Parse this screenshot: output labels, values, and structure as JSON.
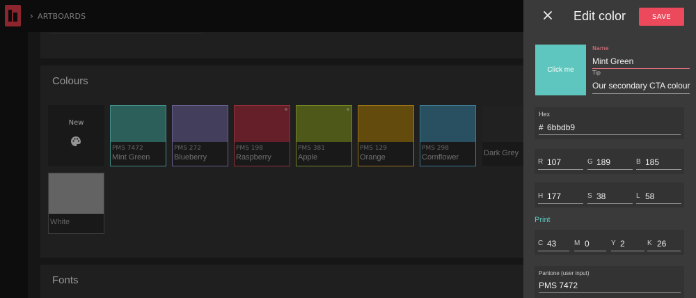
{
  "header": {
    "breadcrumb": "ARTBOARDS",
    "logo_color": "#c2343f"
  },
  "main": {
    "colours_title": "Colours",
    "fonts_title": "Fonts",
    "new_label": "New",
    "swatches": [
      {
        "pms": "PMS 7472",
        "name": "Mint Green",
        "color": "#3e837d",
        "border": "#5ec6be"
      },
      {
        "pms": "PMS 272",
        "name": "Blueberry",
        "color": "#5d5680",
        "border": "#8f86c4"
      },
      {
        "pms": "PMS 198",
        "name": "Raspberry",
        "color": "#8b2b3a",
        "border": "#c9434f"
      },
      {
        "pms": "PMS 381",
        "name": "Apple",
        "color": "#6d7a22",
        "border": "#a3b635"
      },
      {
        "pms": "PMS 129",
        "name": "Orange",
        "color": "#8a6812",
        "border": "#d4a020"
      },
      {
        "pms": "PMS 298",
        "name": "Cornflower",
        "color": "#386f85",
        "border": "#55a8c8"
      },
      {
        "pms": "",
        "name": "Dark Grey",
        "color": "#2e2e2e",
        "border": "#2b2b2b"
      }
    ],
    "white_swatch": {
      "name": "White"
    }
  },
  "panel": {
    "title": "Edit color",
    "save_label": "SAVE",
    "preview_label": "Click me",
    "preview_color": "#5ec6be",
    "accent_color": "#ec4a5c",
    "name_label": "Name",
    "name_value": "Mint Green",
    "tip_label": "Tip",
    "tip_value": "Our secondary CTA colour",
    "hex_label": "Hex",
    "hex_prefix": "#",
    "hex_value": "6bbdb9",
    "rgb": {
      "r_label": "R",
      "r": "107",
      "g_label": "G",
      "g": "189",
      "b_label": "B",
      "b": "185"
    },
    "hsl": {
      "h_label": "H",
      "h": "177",
      "s_label": "S",
      "s": "38",
      "l_label": "L",
      "l": "58"
    },
    "print_label": "Print",
    "cmyk": {
      "c_label": "C",
      "c": "43",
      "m_label": "M",
      "m": "0",
      "y_label": "Y",
      "y": "2",
      "k_label": "K",
      "k": "26"
    },
    "pantone_label": "Pantone (user input)",
    "pantone_value": "PMS 7472"
  }
}
